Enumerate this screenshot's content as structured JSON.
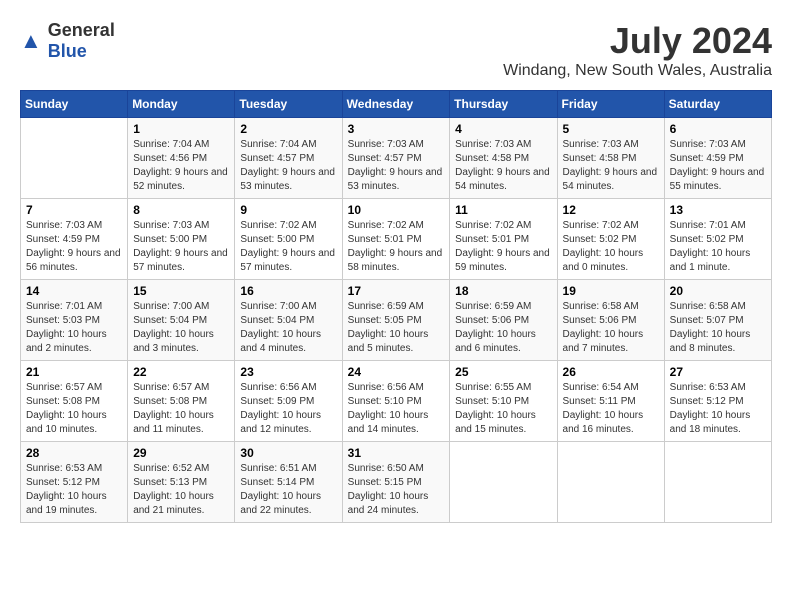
{
  "header": {
    "logo_general": "General",
    "logo_blue": "Blue",
    "title": "July 2024",
    "location": "Windang, New South Wales, Australia"
  },
  "days_of_week": [
    "Sunday",
    "Monday",
    "Tuesday",
    "Wednesday",
    "Thursday",
    "Friday",
    "Saturday"
  ],
  "weeks": [
    [
      {
        "day": "",
        "sunrise": "",
        "sunset": "",
        "daylight": ""
      },
      {
        "day": "1",
        "sunrise": "Sunrise: 7:04 AM",
        "sunset": "Sunset: 4:56 PM",
        "daylight": "Daylight: 9 hours and 52 minutes."
      },
      {
        "day": "2",
        "sunrise": "Sunrise: 7:04 AM",
        "sunset": "Sunset: 4:57 PM",
        "daylight": "Daylight: 9 hours and 53 minutes."
      },
      {
        "day": "3",
        "sunrise": "Sunrise: 7:03 AM",
        "sunset": "Sunset: 4:57 PM",
        "daylight": "Daylight: 9 hours and 53 minutes."
      },
      {
        "day": "4",
        "sunrise": "Sunrise: 7:03 AM",
        "sunset": "Sunset: 4:58 PM",
        "daylight": "Daylight: 9 hours and 54 minutes."
      },
      {
        "day": "5",
        "sunrise": "Sunrise: 7:03 AM",
        "sunset": "Sunset: 4:58 PM",
        "daylight": "Daylight: 9 hours and 54 minutes."
      },
      {
        "day": "6",
        "sunrise": "Sunrise: 7:03 AM",
        "sunset": "Sunset: 4:59 PM",
        "daylight": "Daylight: 9 hours and 55 minutes."
      }
    ],
    [
      {
        "day": "7",
        "sunrise": "Sunrise: 7:03 AM",
        "sunset": "Sunset: 4:59 PM",
        "daylight": "Daylight: 9 hours and 56 minutes."
      },
      {
        "day": "8",
        "sunrise": "Sunrise: 7:03 AM",
        "sunset": "Sunset: 5:00 PM",
        "daylight": "Daylight: 9 hours and 57 minutes."
      },
      {
        "day": "9",
        "sunrise": "Sunrise: 7:02 AM",
        "sunset": "Sunset: 5:00 PM",
        "daylight": "Daylight: 9 hours and 57 minutes."
      },
      {
        "day": "10",
        "sunrise": "Sunrise: 7:02 AM",
        "sunset": "Sunset: 5:01 PM",
        "daylight": "Daylight: 9 hours and 58 minutes."
      },
      {
        "day": "11",
        "sunrise": "Sunrise: 7:02 AM",
        "sunset": "Sunset: 5:01 PM",
        "daylight": "Daylight: 9 hours and 59 minutes."
      },
      {
        "day": "12",
        "sunrise": "Sunrise: 7:02 AM",
        "sunset": "Sunset: 5:02 PM",
        "daylight": "Daylight: 10 hours and 0 minutes."
      },
      {
        "day": "13",
        "sunrise": "Sunrise: 7:01 AM",
        "sunset": "Sunset: 5:02 PM",
        "daylight": "Daylight: 10 hours and 1 minute."
      }
    ],
    [
      {
        "day": "14",
        "sunrise": "Sunrise: 7:01 AM",
        "sunset": "Sunset: 5:03 PM",
        "daylight": "Daylight: 10 hours and 2 minutes."
      },
      {
        "day": "15",
        "sunrise": "Sunrise: 7:00 AM",
        "sunset": "Sunset: 5:04 PM",
        "daylight": "Daylight: 10 hours and 3 minutes."
      },
      {
        "day": "16",
        "sunrise": "Sunrise: 7:00 AM",
        "sunset": "Sunset: 5:04 PM",
        "daylight": "Daylight: 10 hours and 4 minutes."
      },
      {
        "day": "17",
        "sunrise": "Sunrise: 6:59 AM",
        "sunset": "Sunset: 5:05 PM",
        "daylight": "Daylight: 10 hours and 5 minutes."
      },
      {
        "day": "18",
        "sunrise": "Sunrise: 6:59 AM",
        "sunset": "Sunset: 5:06 PM",
        "daylight": "Daylight: 10 hours and 6 minutes."
      },
      {
        "day": "19",
        "sunrise": "Sunrise: 6:58 AM",
        "sunset": "Sunset: 5:06 PM",
        "daylight": "Daylight: 10 hours and 7 minutes."
      },
      {
        "day": "20",
        "sunrise": "Sunrise: 6:58 AM",
        "sunset": "Sunset: 5:07 PM",
        "daylight": "Daylight: 10 hours and 8 minutes."
      }
    ],
    [
      {
        "day": "21",
        "sunrise": "Sunrise: 6:57 AM",
        "sunset": "Sunset: 5:08 PM",
        "daylight": "Daylight: 10 hours and 10 minutes."
      },
      {
        "day": "22",
        "sunrise": "Sunrise: 6:57 AM",
        "sunset": "Sunset: 5:08 PM",
        "daylight": "Daylight: 10 hours and 11 minutes."
      },
      {
        "day": "23",
        "sunrise": "Sunrise: 6:56 AM",
        "sunset": "Sunset: 5:09 PM",
        "daylight": "Daylight: 10 hours and 12 minutes."
      },
      {
        "day": "24",
        "sunrise": "Sunrise: 6:56 AM",
        "sunset": "Sunset: 5:10 PM",
        "daylight": "Daylight: 10 hours and 14 minutes."
      },
      {
        "day": "25",
        "sunrise": "Sunrise: 6:55 AM",
        "sunset": "Sunset: 5:10 PM",
        "daylight": "Daylight: 10 hours and 15 minutes."
      },
      {
        "day": "26",
        "sunrise": "Sunrise: 6:54 AM",
        "sunset": "Sunset: 5:11 PM",
        "daylight": "Daylight: 10 hours and 16 minutes."
      },
      {
        "day": "27",
        "sunrise": "Sunrise: 6:53 AM",
        "sunset": "Sunset: 5:12 PM",
        "daylight": "Daylight: 10 hours and 18 minutes."
      }
    ],
    [
      {
        "day": "28",
        "sunrise": "Sunrise: 6:53 AM",
        "sunset": "Sunset: 5:12 PM",
        "daylight": "Daylight: 10 hours and 19 minutes."
      },
      {
        "day": "29",
        "sunrise": "Sunrise: 6:52 AM",
        "sunset": "Sunset: 5:13 PM",
        "daylight": "Daylight: 10 hours and 21 minutes."
      },
      {
        "day": "30",
        "sunrise": "Sunrise: 6:51 AM",
        "sunset": "Sunset: 5:14 PM",
        "daylight": "Daylight: 10 hours and 22 minutes."
      },
      {
        "day": "31",
        "sunrise": "Sunrise: 6:50 AM",
        "sunset": "Sunset: 5:15 PM",
        "daylight": "Daylight: 10 hours and 24 minutes."
      },
      {
        "day": "",
        "sunrise": "",
        "sunset": "",
        "daylight": ""
      },
      {
        "day": "",
        "sunrise": "",
        "sunset": "",
        "daylight": ""
      },
      {
        "day": "",
        "sunrise": "",
        "sunset": "",
        "daylight": ""
      }
    ]
  ]
}
